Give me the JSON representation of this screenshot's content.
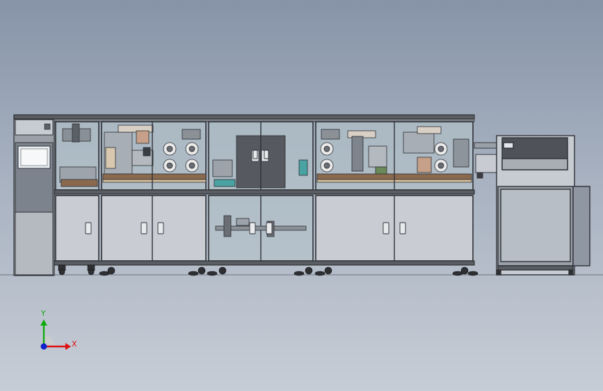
{
  "viewport": {
    "background_top": "#8794a8",
    "background_bottom": "#c7cdd6"
  },
  "machine": {
    "frame_color": "#3a3d42",
    "panel_color": "#c9cdd3",
    "glass_color": "#b7c6cc",
    "conveyor_color": "#8a6a4e",
    "accent_teal": "#4aa3a3"
  },
  "triad": {
    "x_label": "X",
    "y_label": "Y",
    "x_color": "#d11",
    "y_color": "#1a1",
    "origin_color": "#12c"
  }
}
